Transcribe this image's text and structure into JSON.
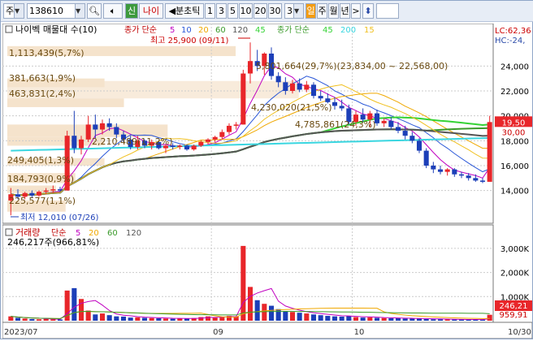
{
  "toolbar": {
    "market_select": "주",
    "code_value": "138610",
    "search_icon": "search-icon",
    "sound_icon": "speaker-icon",
    "new_high_btn": "신",
    "stock_name": "나이",
    "split_label": "◀분초틱",
    "interval_buttons": [
      "1",
      "3",
      "5",
      "10",
      "20",
      "30"
    ],
    "count_value": "3",
    "period_buttons": [
      "일",
      "주",
      "월",
      "년"
    ],
    "active_period": "일",
    "next_arrow": ">",
    "updown_icon": "up-down-arrow-icon",
    "blank_input": ""
  },
  "price_legend": {
    "name": "나이벡 매물대 수(10)",
    "ma_title": "종가 단순",
    "ma_periods": [
      "5",
      "10",
      "20",
      "60",
      "120",
      "45"
    ],
    "ma2_title": "종가 단순",
    "ma2_periods": [
      "45",
      "200",
      "15"
    ]
  },
  "price_annotations": {
    "high": "최고 25,900 (09/11)",
    "low": "최저 12,010 (07/26)",
    "a1": "1,113,439(5,7%)",
    "a2": "381,663(1,9%)",
    "a3": "463,831(2,4%)",
    "a4": "5,801,664(29,7%)(23,834,00 ~ 22,568,00)",
    "a5": "4,230,020(21,5%)",
    "a6": "4,785,861(24,3%)",
    "a7": "2,210,489(11,2%)",
    "a8": "249,405(1,3%)",
    "a9": "184,793(0,9%)",
    "a10": "225,577(1,1%)"
  },
  "right_labels": {
    "lc": "LC:62,36",
    "hc": "HC:-24,",
    "current_price": "19,50",
    "current_pct": "30,00"
  },
  "volume_legend": {
    "title": "거래량",
    "ma_title": "단순",
    "ma_periods": [
      "5",
      "20",
      "60",
      "120"
    ],
    "current": "246,217주(966,81%)",
    "current_value_box": "246,21",
    "ma_value_box": "959,91"
  },
  "colors": {
    "up": "#e8262a",
    "down": "#1c3fb8",
    "ma5": "#c000c0",
    "ma10": "#2a57d8",
    "ma20": "#f0a800",
    "ma60": "#3a9a2a",
    "ma120": "#555555",
    "ma45": "#35d335",
    "ma200": "#3ad6e0",
    "ma15": "#f0c020",
    "profile": "#f5e3cc"
  },
  "chart_data": {
    "type": "candlestick",
    "x": [
      "2023/07",
      "09",
      "10",
      "10/30"
    ],
    "price_yticks": [
      14000,
      16000,
      18000,
      20000,
      22000,
      24000
    ],
    "price_ylim": [
      11500,
      26500
    ],
    "volume_yticks": [
      "1,000K",
      "2,000K",
      "3,000K"
    ],
    "volume_ylim": [
      0,
      3500
    ],
    "candles": [
      {
        "o": 13200,
        "h": 14200,
        "l": 12010,
        "c": 13700
      },
      {
        "o": 13700,
        "h": 14100,
        "c": 13500,
        "l": 13300
      },
      {
        "o": 13500,
        "h": 13900,
        "l": 13300,
        "c": 13800
      },
      {
        "o": 13800,
        "h": 14000,
        "l": 13400,
        "c": 13600
      },
      {
        "o": 13600,
        "h": 14000,
        "l": 13500,
        "c": 13900
      },
      {
        "o": 13900,
        "h": 14200,
        "l": 13700,
        "c": 14000
      },
      {
        "o": 14000,
        "h": 14400,
        "l": 13800,
        "c": 14100
      },
      {
        "o": 14100,
        "h": 14300,
        "l": 13900,
        "c": 14000
      },
      {
        "o": 14000,
        "h": 18800,
        "l": 14000,
        "c": 18400
      },
      {
        "o": 18400,
        "h": 20400,
        "l": 17000,
        "c": 17400
      },
      {
        "o": 17400,
        "h": 18400,
        "l": 16900,
        "c": 18100
      },
      {
        "o": 18100,
        "h": 20000,
        "l": 17900,
        "c": 19300
      },
      {
        "o": 19300,
        "h": 20100,
        "l": 18200,
        "c": 18900
      },
      {
        "o": 18900,
        "h": 19700,
        "l": 18500,
        "c": 19400
      },
      {
        "o": 19400,
        "h": 19800,
        "l": 18800,
        "c": 19100
      },
      {
        "o": 19100,
        "h": 19400,
        "l": 18200,
        "c": 18500
      },
      {
        "o": 18500,
        "h": 18800,
        "l": 17900,
        "c": 18100
      },
      {
        "o": 18100,
        "h": 18400,
        "l": 17300,
        "c": 17500
      },
      {
        "o": 17500,
        "h": 18400,
        "l": 17300,
        "c": 18000
      },
      {
        "o": 18000,
        "h": 18100,
        "l": 17400,
        "c": 17600
      },
      {
        "o": 17600,
        "h": 18100,
        "l": 17300,
        "c": 17900
      },
      {
        "o": 17900,
        "h": 18000,
        "l": 17300,
        "c": 17400
      },
      {
        "o": 17400,
        "h": 17700,
        "l": 17000,
        "c": 17600
      },
      {
        "o": 17600,
        "h": 17800,
        "l": 17300,
        "c": 17500
      },
      {
        "o": 17500,
        "h": 17700,
        "l": 17300,
        "c": 17600
      },
      {
        "o": 17600,
        "h": 17700,
        "l": 17200,
        "c": 17300
      },
      {
        "o": 17300,
        "h": 17700,
        "l": 17200,
        "c": 17600
      },
      {
        "o": 17600,
        "h": 18000,
        "l": 17500,
        "c": 17900
      },
      {
        "o": 17900,
        "h": 18200,
        "l": 17700,
        "c": 18100
      },
      {
        "o": 18100,
        "h": 18400,
        "l": 17900,
        "c": 18300
      },
      {
        "o": 18300,
        "h": 18900,
        "l": 18100,
        "c": 18700
      },
      {
        "o": 18700,
        "h": 19400,
        "l": 18500,
        "c": 19200
      },
      {
        "o": 19200,
        "h": 19500,
        "l": 18900,
        "c": 19300
      },
      {
        "o": 19300,
        "h": 23700,
        "l": 19300,
        "c": 23400
      },
      {
        "o": 23400,
        "h": 25900,
        "l": 22600,
        "c": 24400
      },
      {
        "o": 24400,
        "h": 25300,
        "l": 23600,
        "c": 24000
      },
      {
        "o": 24000,
        "h": 25100,
        "l": 23300,
        "c": 25000
      },
      {
        "o": 25000,
        "h": 25500,
        "l": 22900,
        "c": 23200
      },
      {
        "o": 23200,
        "h": 23500,
        "l": 22300,
        "c": 22700
      },
      {
        "o": 22700,
        "h": 23100,
        "l": 21700,
        "c": 22000
      },
      {
        "o": 22000,
        "h": 22900,
        "l": 21800,
        "c": 22600
      },
      {
        "o": 22600,
        "h": 23000,
        "l": 21900,
        "c": 22100
      },
      {
        "o": 22100,
        "h": 22800,
        "l": 21900,
        "c": 22500
      },
      {
        "o": 22500,
        "h": 22700,
        "l": 21400,
        "c": 21600
      },
      {
        "o": 21600,
        "h": 22000,
        "l": 21200,
        "c": 21400
      },
      {
        "o": 21400,
        "h": 21800,
        "l": 21000,
        "c": 21100
      },
      {
        "o": 21100,
        "h": 21500,
        "l": 20500,
        "c": 20800
      },
      {
        "o": 20800,
        "h": 21300,
        "l": 20400,
        "c": 20600
      },
      {
        "o": 20600,
        "h": 20900,
        "l": 19300,
        "c": 19500
      },
      {
        "o": 19500,
        "h": 20400,
        "l": 19200,
        "c": 20100
      },
      {
        "o": 20100,
        "h": 20600,
        "l": 19500,
        "c": 19700
      },
      {
        "o": 19700,
        "h": 20400,
        "l": 19100,
        "c": 20200
      },
      {
        "o": 20200,
        "h": 20500,
        "l": 19200,
        "c": 19400
      },
      {
        "o": 19400,
        "h": 19800,
        "l": 19100,
        "c": 19600
      },
      {
        "o": 19600,
        "h": 19900,
        "l": 18900,
        "c": 19100
      },
      {
        "o": 19100,
        "h": 19500,
        "l": 18600,
        "c": 18800
      },
      {
        "o": 18800,
        "h": 19200,
        "l": 18100,
        "c": 18400
      },
      {
        "o": 18400,
        "h": 18700,
        "l": 17800,
        "c": 18000
      },
      {
        "o": 18000,
        "h": 18200,
        "l": 17000,
        "c": 17200
      },
      {
        "o": 17200,
        "h": 17400,
        "l": 15800,
        "c": 16000
      },
      {
        "o": 16000,
        "h": 16300,
        "l": 15400,
        "c": 15700
      },
      {
        "o": 15700,
        "h": 16000,
        "l": 15300,
        "c": 15500
      },
      {
        "o": 15500,
        "h": 15800,
        "l": 15200,
        "c": 15700
      },
      {
        "o": 15700,
        "h": 15800,
        "l": 15100,
        "c": 15300
      },
      {
        "o": 15300,
        "h": 15500,
        "l": 15000,
        "c": 15200
      },
      {
        "o": 15200,
        "h": 15400,
        "l": 14800,
        "c": 15000
      },
      {
        "o": 15000,
        "h": 15300,
        "l": 14700,
        "c": 14800
      },
      {
        "o": 14800,
        "h": 15000,
        "l": 14600,
        "c": 14700
      },
      {
        "o": 14700,
        "h": 20000,
        "l": 14700,
        "c": 19500
      }
    ],
    "volumes": [
      180,
      120,
      90,
      70,
      60,
      80,
      60,
      50,
      1250,
      1350,
      900,
      420,
      260,
      300,
      230,
      180,
      170,
      130,
      140,
      120,
      110,
      100,
      90,
      80,
      100,
      90,
      110,
      150,
      180,
      140,
      160,
      200,
      180,
      3100,
      1400,
      850,
      700,
      620,
      480,
      400,
      360,
      330,
      300,
      260,
      230,
      200,
      180,
      170,
      200,
      150,
      130,
      140,
      120,
      110,
      100,
      100,
      90,
      95,
      85,
      70,
      60,
      60,
      55,
      50,
      50,
      45,
      45,
      40,
      246
    ]
  }
}
